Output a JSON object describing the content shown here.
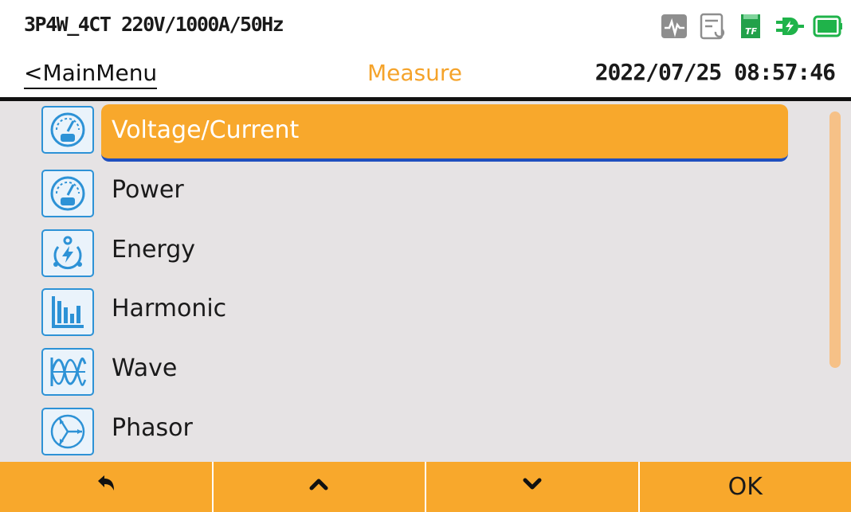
{
  "header": {
    "config": "3P4W_4CT 220V/1000A/50Hz",
    "status_icons": [
      "waveform-icon",
      "document-icon",
      "tf-card-icon",
      "charging-plug-icon",
      "battery-icon"
    ],
    "tf_label": "TF"
  },
  "nav": {
    "back_label": "<MainMenu",
    "title": "Measure",
    "datetime": "2022/07/25 08:57:46"
  },
  "menu": {
    "items": [
      {
        "label": "Voltage/Current",
        "icon": "gauge-icon",
        "selected": true
      },
      {
        "label": "Power",
        "icon": "gauge-icon",
        "selected": false
      },
      {
        "label": "Energy",
        "icon": "energy-cycle-icon",
        "selected": false
      },
      {
        "label": "Harmonic",
        "icon": "bar-chart-icon",
        "selected": false
      },
      {
        "label": "Wave",
        "icon": "wave-icon",
        "selected": false
      },
      {
        "label": "Phasor",
        "icon": "phasor-icon",
        "selected": false
      }
    ]
  },
  "footer": {
    "keys": [
      {
        "icon": "back-arrow-icon"
      },
      {
        "icon": "chevron-up-icon"
      },
      {
        "icon": "chevron-down-icon"
      },
      {
        "label": "OK"
      }
    ]
  },
  "colors": {
    "accent": "#f8a82c",
    "title": "#f5a32a",
    "icon_border": "#2d92d6",
    "underline": "#1f4fbf"
  }
}
